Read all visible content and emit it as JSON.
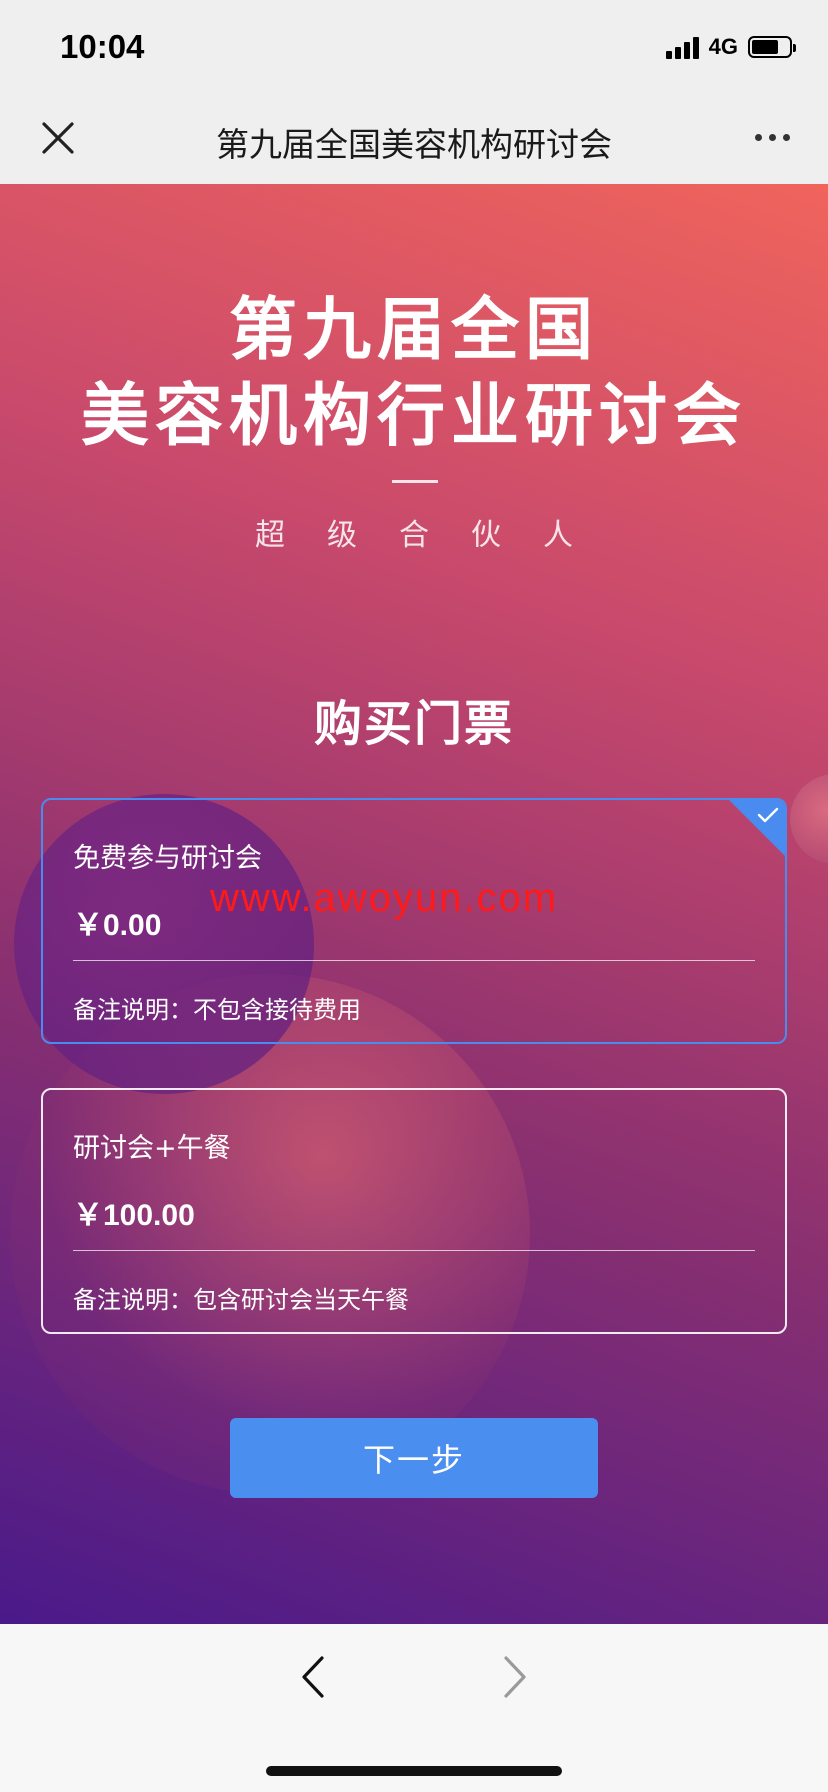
{
  "status": {
    "time": "10:04",
    "network": "4G"
  },
  "nav": {
    "title": "第九届全国美容机构研讨会",
    "close_icon": "close-icon",
    "more_icon": "more-icon"
  },
  "hero": {
    "title_line1": "第九届全国",
    "title_line2": "美容机构行业研讨会",
    "subtitle": "超级合伙人"
  },
  "section_title": "购买门票",
  "tickets": [
    {
      "name": "免费参与研讨会",
      "price": "￥0.00",
      "note": "备注说明：不包含接待费用",
      "selected": true
    },
    {
      "name": "研讨会+午餐",
      "price": "￥100.00",
      "note": "备注说明：包含研讨会当天午餐",
      "selected": false
    }
  ],
  "watermark": "www.awoyun.com",
  "next_button": "下一步",
  "colors": {
    "accent": "#4a8ff0",
    "gradient_top": "#f0645c",
    "gradient_bottom": "#4a1a8a",
    "watermark": "#ff1a1a"
  }
}
